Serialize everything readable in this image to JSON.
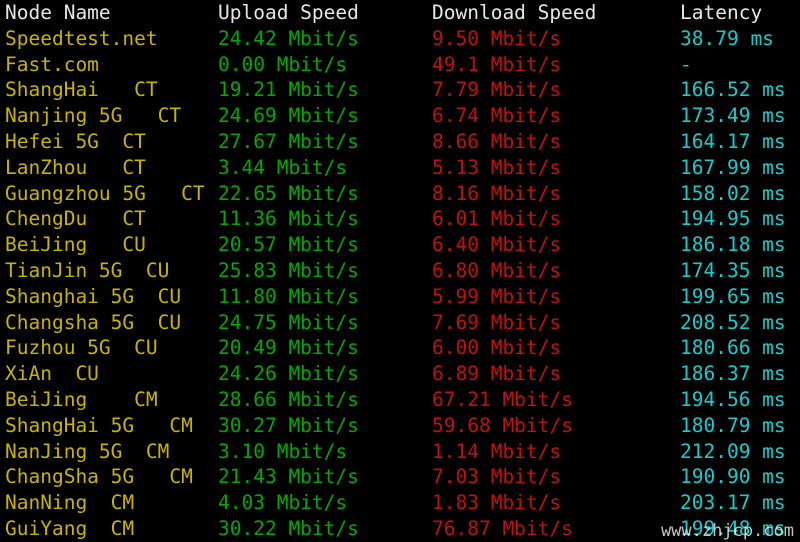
{
  "terminal": {
    "background_color": "#000000",
    "header_color": "#e6e6e6",
    "node_color": "#c8b400",
    "upload_color": "#00a800",
    "download_color": "#c01010",
    "latency_color": "#16cdcd"
  },
  "table": {
    "headers": {
      "node": "Node Name",
      "upload": "Upload Speed",
      "download": "Download Speed",
      "latency": "Latency"
    },
    "rows": [
      {
        "node": "Speedtest.net",
        "upload": "24.42 Mbit/s",
        "download": "9.50 Mbit/s",
        "latency": "38.79 ms"
      },
      {
        "node": "Fast.com",
        "upload": "0.00 Mbit/s",
        "download": "49.1 Mbit/s",
        "latency": "-"
      },
      {
        "node": "ShangHai   CT",
        "upload": "19.21 Mbit/s",
        "download": "7.79 Mbit/s",
        "latency": "166.52 ms"
      },
      {
        "node": "Nanjing 5G   CT",
        "upload": "24.69 Mbit/s",
        "download": "6.74 Mbit/s",
        "latency": "173.49 ms"
      },
      {
        "node": "Hefei 5G  CT",
        "upload": "27.67 Mbit/s",
        "download": "8.66 Mbit/s",
        "latency": "164.17 ms"
      },
      {
        "node": "LanZhou   CT",
        "upload": "3.44 Mbit/s",
        "download": "5.13 Mbit/s",
        "latency": "167.99 ms"
      },
      {
        "node": "Guangzhou 5G   CT",
        "upload": "22.65 Mbit/s",
        "download": "8.16 Mbit/s",
        "latency": "158.02 ms"
      },
      {
        "node": "ChengDu   CT",
        "upload": "11.36 Mbit/s",
        "download": "6.01 Mbit/s",
        "latency": "194.95 ms"
      },
      {
        "node": "BeiJing   CU",
        "upload": "20.57 Mbit/s",
        "download": "6.40 Mbit/s",
        "latency": "186.18 ms"
      },
      {
        "node": "TianJin 5G  CU",
        "upload": "25.83 Mbit/s",
        "download": "6.80 Mbit/s",
        "latency": "174.35 ms"
      },
      {
        "node": "Shanghai 5G  CU",
        "upload": "11.80 Mbit/s",
        "download": "5.99 Mbit/s",
        "latency": "199.65 ms"
      },
      {
        "node": "Changsha 5G  CU",
        "upload": "24.75 Mbit/s",
        "download": "7.69 Mbit/s",
        "latency": "208.52 ms"
      },
      {
        "node": "Fuzhou 5G  CU",
        "upload": "20.49 Mbit/s",
        "download": "6.00 Mbit/s",
        "latency": "180.66 ms"
      },
      {
        "node": "XiAn  CU",
        "upload": "24.26 Mbit/s",
        "download": "6.89 Mbit/s",
        "latency": "186.37 ms"
      },
      {
        "node": "BeiJing    CM",
        "upload": "28.66 Mbit/s",
        "download": "67.21 Mbit/s",
        "latency": "194.56 ms"
      },
      {
        "node": "ShangHai 5G   CM",
        "upload": "30.27 Mbit/s",
        "download": "59.68 Mbit/s",
        "latency": "180.79 ms"
      },
      {
        "node": "NanJing 5G  CM",
        "upload": "3.10 Mbit/s",
        "download": "1.14 Mbit/s",
        "latency": "212.09 ms"
      },
      {
        "node": "ChangSha 5G   CM",
        "upload": "21.43 Mbit/s",
        "download": "7.03 Mbit/s",
        "latency": "190.90 ms"
      },
      {
        "node": "NanNing  CM",
        "upload": "4.03 Mbit/s",
        "download": "1.83 Mbit/s",
        "latency": "203.17 ms"
      },
      {
        "node": "GuiYang  CM",
        "upload": "30.22 Mbit/s",
        "download": "76.87 Mbit/s",
        "latency": "199.48 ms"
      }
    ]
  },
  "watermark": {
    "text": "www.zhjcp.com"
  }
}
